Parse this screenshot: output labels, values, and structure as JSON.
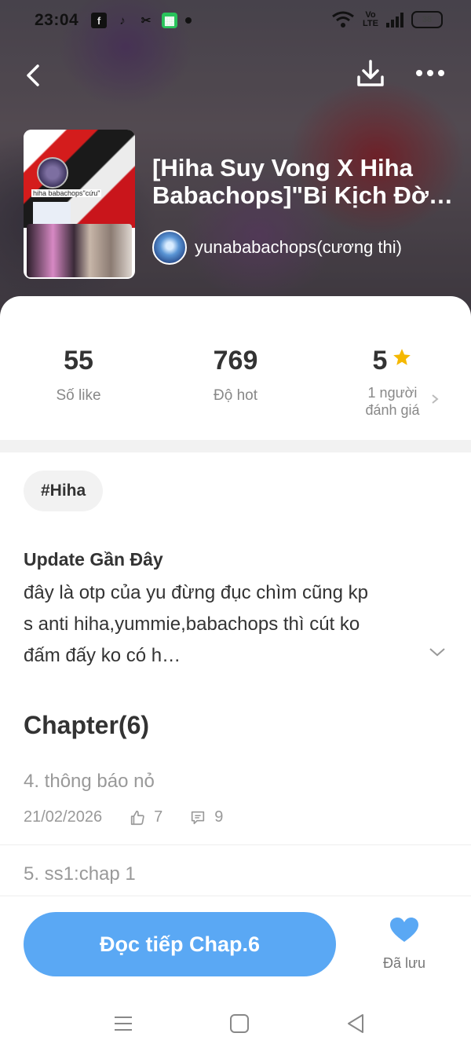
{
  "status_bar": {
    "time": "23:04",
    "battery": "38"
  },
  "header": {
    "title_line1": "[Hiha Suy Vong X Hiha",
    "title_line2": "Babachops]\"Bi Kịch Đời…",
    "author": "yunababachops(cương thi)",
    "cover_text": "hiha babachops\"cứu\""
  },
  "stats": {
    "likes_value": "55",
    "likes_label": "Số like",
    "hot_value": "769",
    "hot_label": "Độ hot",
    "rating_value": "5",
    "rating_label_line1": "1 người",
    "rating_label_line2": "đánh giá"
  },
  "tag": "#Hiha",
  "update": {
    "title": "Update Gần Đây",
    "line1": "đây là otp của yu đừng đục chìm cũng kp",
    "line2": "s anti hiha,yummie,babachops thì cút ko",
    "line3": "đấm đấy ko có h…"
  },
  "chapters": {
    "heading": "Chapter(6)",
    "items": [
      {
        "title": "4. thông báo nỏ",
        "date": "21/02/2026",
        "likes": "7",
        "comments": "9"
      },
      {
        "title": "5. ss1:chap 1"
      }
    ]
  },
  "bottom": {
    "read_button": "Đọc tiếp Chap.6",
    "saved_label": "Đã lưu"
  },
  "colors": {
    "accent": "#5aa8f4",
    "star": "#f5b800"
  }
}
